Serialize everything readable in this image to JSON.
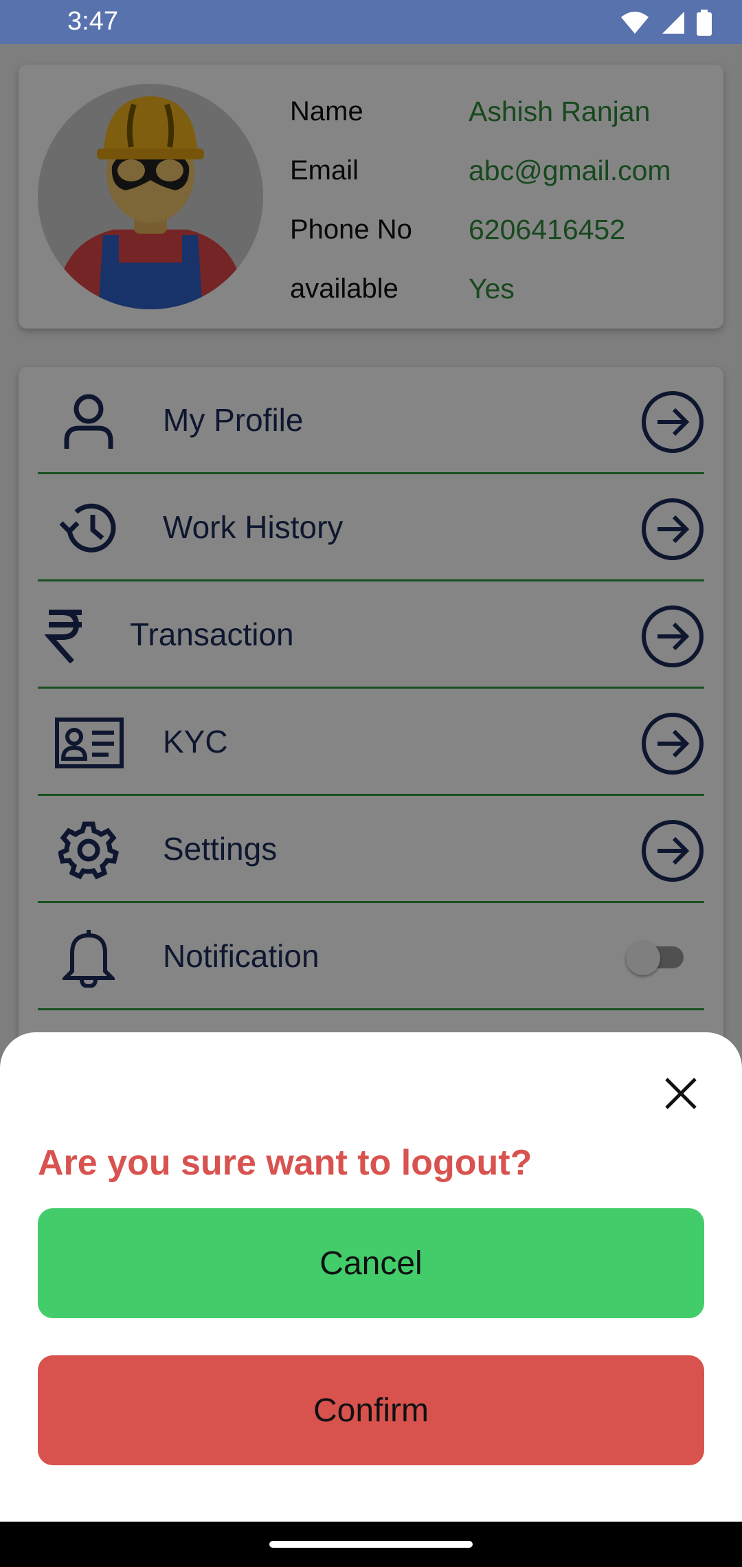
{
  "status_bar": {
    "time": "3:47",
    "icons": [
      "wifi-icon",
      "signal-icon",
      "battery-icon"
    ]
  },
  "profile": {
    "fields": [
      {
        "label": "Name",
        "value": "Ashish Ranjan"
      },
      {
        "label": "Email",
        "value": "abc@gmail.com"
      },
      {
        "label": "Phone No",
        "value": "6206416452"
      },
      {
        "label": "available",
        "value": "Yes"
      }
    ]
  },
  "menu": {
    "items": [
      {
        "label": "My Profile",
        "icon": "user-icon"
      },
      {
        "label": "Work History",
        "icon": "history-icon"
      },
      {
        "label": "Transaction",
        "icon": "rupee-icon"
      },
      {
        "label": "KYC",
        "icon": "id-card-icon"
      },
      {
        "label": "Settings",
        "icon": "gear-icon"
      },
      {
        "label": "Notification",
        "icon": "bell-icon",
        "toggle": false
      }
    ]
  },
  "logout_dialog": {
    "title": "Are you sure want to logout?",
    "cancel_label": "Cancel",
    "confirm_label": "Confirm"
  },
  "colors": {
    "status_bar": "#5872ad",
    "value_green": "#2e8b3a",
    "menu_text": "#1c2d5a",
    "divider": "#2f9a3c",
    "cancel": "#42cd6a",
    "confirm": "#d9534e",
    "title_red": "#d8534f"
  }
}
